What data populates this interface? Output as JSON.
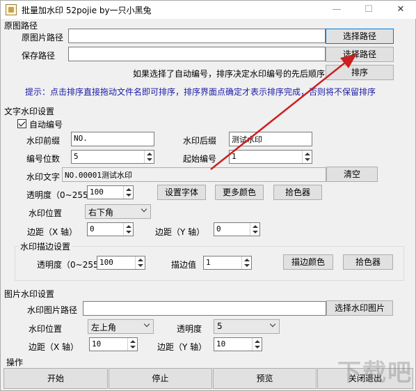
{
  "window": {
    "title": "批量加水印 52pojie by一只小黑兔",
    "min_label": "—",
    "max_label": "☐",
    "close_label": "✕"
  },
  "source": {
    "section": "原图路径",
    "src_label": "原图片路径",
    "src_value": "",
    "choose_src": "选择路径",
    "save_label": "保存路径",
    "save_value": "",
    "choose_save": "选择路径",
    "auto_note": "如果选择了自动编号，排序决定水印编号的先后顺序",
    "sort_button": "排序",
    "hint": "提示：点击排序直接拖动文件名即可排序，排序界面点确定才表示排序完成，否则将不保留排序"
  },
  "text_wm": {
    "section": "文字水印设置",
    "auto_number_label": "自动编号",
    "auto_number_checked": true,
    "prefix_label": "水印前缀",
    "prefix_value": "NO.",
    "suffix_label": "水印后缀",
    "suffix_value": "测试水印",
    "digits_label": "编号位数",
    "digits_value": "5",
    "start_label": "起始编号",
    "start_value": "1",
    "text_label": "水印文字",
    "text_value": "NO.00001测试水印",
    "clear_button": "清空",
    "opacity_label": "透明度（0~255）",
    "opacity_value": "100",
    "font_button": "设置字体",
    "more_colors_button": "更多颜色",
    "picker_button": "拾色器",
    "position_label": "水印位置",
    "position_value": "右下角",
    "margin_x_label": "边距（X 轴）",
    "margin_x_value": "0",
    "margin_y_label": "边距（Y 轴）",
    "margin_y_value": "0"
  },
  "stroke": {
    "section": "水印描边设置",
    "opacity_label": "透明度（0~255）",
    "opacity_value": "100",
    "stroke_label": "描边值",
    "stroke_value": "1",
    "stroke_color_button": "描边颜色",
    "picker_button": "拾色器"
  },
  "image_wm": {
    "section": "图片水印设置",
    "path_label": "水印图片路径",
    "path_value": "",
    "choose_button": "选择水印图片",
    "position_label": "水印位置",
    "position_value": "左上角",
    "opacity_label": "透明度",
    "opacity_value": "5",
    "margin_x_label": "边距（X 轴）",
    "margin_x_value": "10",
    "margin_y_label": "边距（Y 轴）",
    "margin_y_value": "10"
  },
  "actions": {
    "section": "操作",
    "start": "开始",
    "stop": "停止",
    "preview": "预览",
    "exit": "关闭退出"
  },
  "watermark_text": "下载吧",
  "colors": {
    "hint": "#1a1aa6",
    "arrow": "#cc1f1f",
    "focus": "#0078d7"
  }
}
